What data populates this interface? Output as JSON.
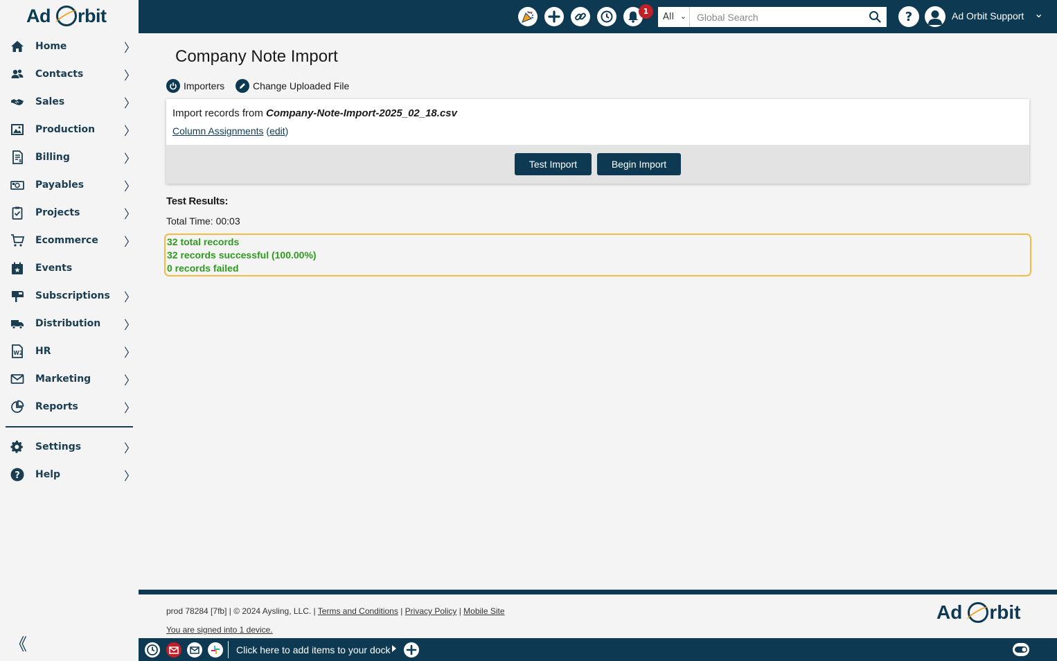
{
  "brand": {
    "left": "Ad",
    "right": "rbit"
  },
  "nav": {
    "items": [
      {
        "label": "Home",
        "icon": "home-icon"
      },
      {
        "label": "Contacts",
        "icon": "contacts-icon"
      },
      {
        "label": "Sales",
        "icon": "handshake-icon"
      },
      {
        "label": "Production",
        "icon": "image-icon"
      },
      {
        "label": "Billing",
        "icon": "invoice-icon"
      },
      {
        "label": "Payables",
        "icon": "money-icon"
      },
      {
        "label": "Projects",
        "icon": "clipboard-icon"
      },
      {
        "label": "Ecommerce",
        "icon": "cart-icon"
      },
      {
        "label": "Events",
        "icon": "calendar-icon"
      },
      {
        "label": "Subscriptions",
        "icon": "mailbox-icon"
      },
      {
        "label": "Distribution",
        "icon": "truck-icon"
      },
      {
        "label": "HR",
        "icon": "w2-form-icon"
      },
      {
        "label": "Marketing",
        "icon": "envelope-icon"
      },
      {
        "label": "Reports",
        "icon": "pie-chart-icon"
      }
    ],
    "bottom_items": [
      {
        "label": "Settings",
        "icon": "gear-icon"
      },
      {
        "label": "Help",
        "icon": "question-icon"
      }
    ],
    "collapse_glyph": "《"
  },
  "topbar": {
    "notification_count": "1",
    "search_scope": "All",
    "search_placeholder": "Global Search",
    "help_glyph": "?",
    "user_name": "Ad Orbit Support"
  },
  "main": {
    "title": "Company Note Import",
    "links": {
      "importers": "Importers",
      "change_file": "Change Uploaded File"
    },
    "card": {
      "title_prefix": "Import records from ",
      "file_name": "Company-Note-Import-2025_02_18.csv",
      "column_assignments": "Column Assignments",
      "edit_label": "edit",
      "test_button": "Test Import",
      "begin_button": "Begin Import"
    },
    "results": {
      "heading": "Test Results:",
      "total_time": "Total Time: 00:03",
      "total_records": "32 total records",
      "successful": "32 records successful (100.00%)",
      "failed": "0 records failed"
    }
  },
  "footer": {
    "build": "prod 78284 [7fb] | © 2024 Aysling, LLC. |",
    "terms": "Terms and Conditions",
    "privacy": "Privacy Policy",
    "mobile": "Mobile Site",
    "separator": "|",
    "signed_in": "You are signed into 1 device."
  },
  "dock": {
    "text": "Click here to add items to your dock"
  },
  "colors": {
    "navy": "#0d3a52",
    "accent_orange": "#f0a024",
    "success_green": "#2e9a1e",
    "highlight_border": "#f6b942",
    "badge_red": "#c0202a"
  }
}
